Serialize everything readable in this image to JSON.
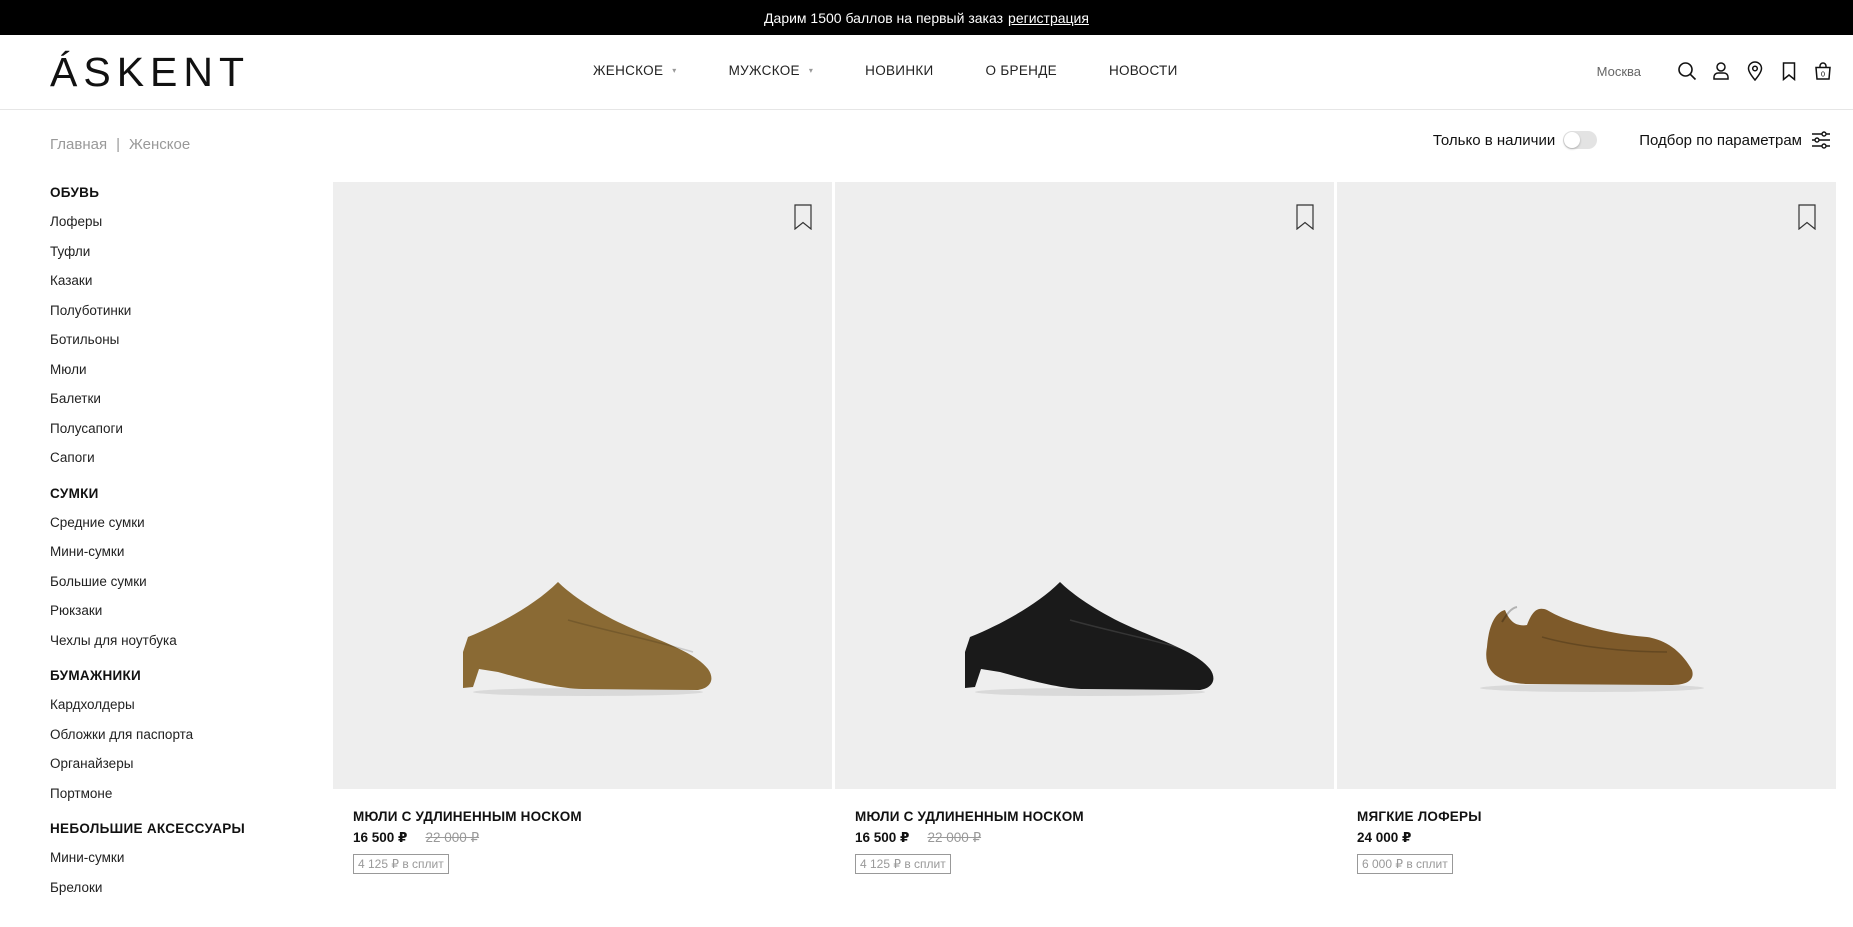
{
  "promo": {
    "text": "Дарим 1500 баллов на первый заказ",
    "link": "регистрация"
  },
  "header": {
    "logo": "ÁSKENT",
    "nav": [
      {
        "label": "ЖЕНСКОЕ",
        "has_dropdown": true
      },
      {
        "label": "МУЖСКОЕ",
        "has_dropdown": true
      },
      {
        "label": "НОВИНКИ",
        "has_dropdown": false
      },
      {
        "label": "О БРЕНДЕ",
        "has_dropdown": false
      },
      {
        "label": "НОВОСТИ",
        "has_dropdown": false
      }
    ],
    "city": "Москва",
    "icons": [
      "search-icon",
      "user-icon",
      "location-pin-icon",
      "bookmark-icon",
      "cart-icon"
    ],
    "cart_count": "0"
  },
  "breadcrumb": [
    "Главная",
    "Женское"
  ],
  "toolbar": {
    "in_stock_label": "Только в наличии",
    "in_stock_on": false,
    "filter_label": "Подбор по параметрам"
  },
  "sidebar": [
    {
      "title": "ОБУВЬ",
      "items": [
        "Лоферы",
        "Туфли",
        "Казаки",
        "Полуботинки",
        "Ботильоны",
        "Мюли",
        "Балетки",
        "Полусапоги",
        "Сапоги"
      ]
    },
    {
      "title": "СУМКИ",
      "items": [
        "Средние сумки",
        "Мини-сумки",
        "Большие сумки",
        "Рюкзаки",
        "Чехлы для ноутбука"
      ]
    },
    {
      "title": "БУМАЖНИКИ",
      "items": [
        "Кардхолдеры",
        "Обложки для паспорта",
        "Органайзеры",
        "Портмоне"
      ]
    },
    {
      "title": "НЕБОЛЬШИЕ АКСЕССУАРЫ",
      "items": [
        "Мини-сумки",
        "Брелоки"
      ]
    }
  ],
  "products": [
    {
      "title": "МЮЛИ С УДЛИНЕННЫМ НОСКОМ",
      "price": "16 500 ₽",
      "old_price": "22 000 ₽",
      "split": "4 125 ₽ в сплит",
      "color": "#8a6a34"
    },
    {
      "title": "МЮЛИ С УДЛИНЕННЫМ НОСКОМ",
      "price": "16 500 ₽",
      "old_price": "22 000 ₽",
      "split": "4 125 ₽ в сплит",
      "color": "#1a1a1a"
    },
    {
      "title": "МЯГКИЕ ЛОФЕРЫ",
      "price": "24 000 ₽",
      "old_price": "",
      "split": "6 000 ₽ в сплит",
      "color": "#7e5a2a"
    }
  ]
}
